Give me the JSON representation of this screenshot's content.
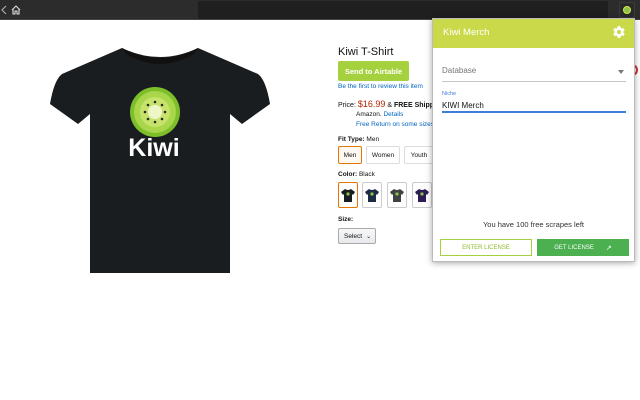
{
  "browser": {
    "back_icon": "back-arrow-icon",
    "home_icon": "home-icon",
    "extension_icon": "kiwi-extension-icon"
  },
  "product": {
    "image_brand_text": "Kiwi",
    "title": "Kiwi T-Shirt",
    "send_button": "Send to Airtable",
    "review_link": "Be the first to review this item",
    "price_label": "Price:",
    "price": "$16.99",
    "shipping_prefix": "& ",
    "shipping_bold": "FREE Shipping",
    "amazon_text": "Amazon.",
    "details_link": "Details",
    "free_return": "Free Return on some sizes",
    "fit_type_label": "Fit Type:",
    "fit_type_value": "Men",
    "fit_options": [
      "Men",
      "Women",
      "Youth"
    ],
    "color_label": "Color:",
    "color_value": "Black",
    "size_label": "Size:",
    "size_select": "Select"
  },
  "popup": {
    "title": "Kiwi Merch",
    "settings_icon": "gear-icon",
    "database_placeholder": "Database",
    "niche_label": "Niche",
    "niche_value": "KIWI Merch",
    "scrapes_text": "You have 100 free scrapes left",
    "enter_license": "ENTER LICENSE",
    "get_license": "GET LICENSE"
  },
  "colors": {
    "header": "#c9d94a",
    "send_button": "#a4d13d",
    "get_license": "#4caf50",
    "price": "#b12704",
    "link": "#0066c0",
    "focus": "#3f7bd8"
  }
}
